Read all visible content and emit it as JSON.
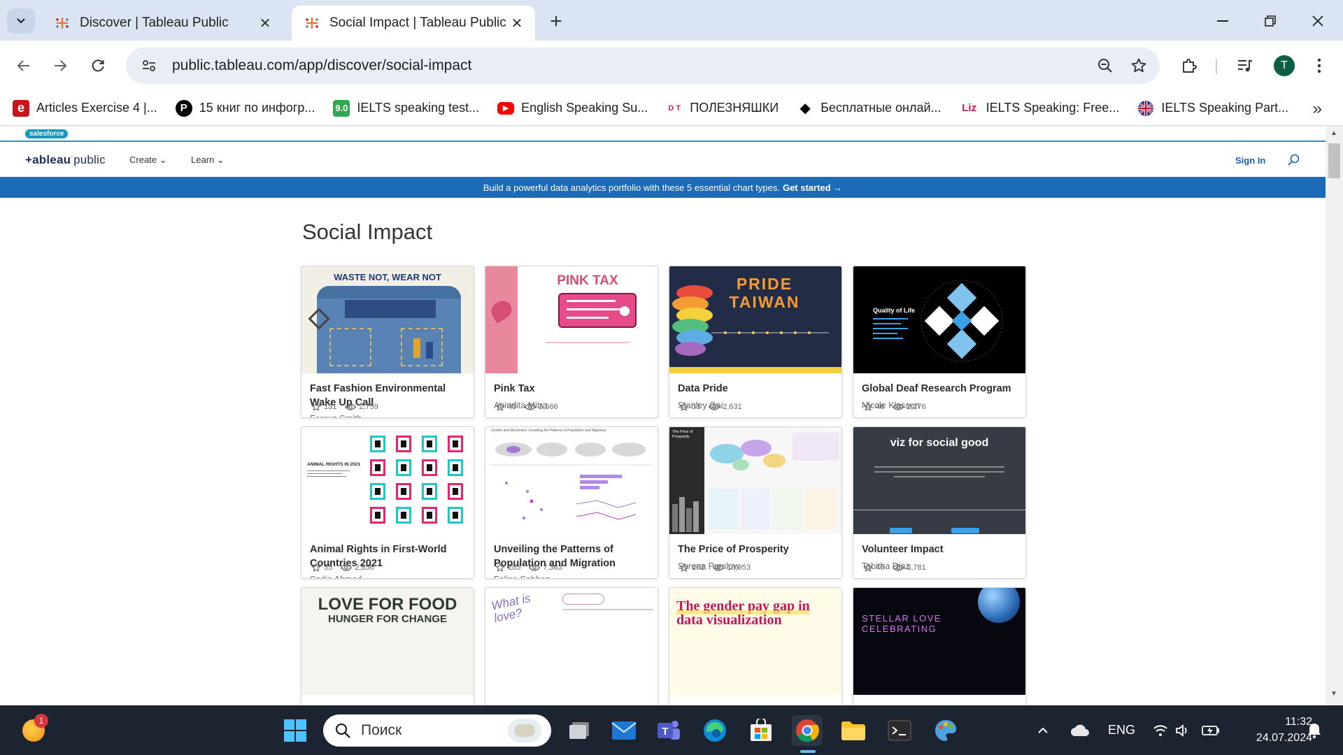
{
  "browser": {
    "tabs": [
      {
        "title": "Discover | Tableau Public",
        "active": false
      },
      {
        "title": "Social Impact | Tableau Public",
        "active": true
      }
    ],
    "url": "public.tableau.com/app/discover/social-impact",
    "profile_initial": "T",
    "bookmarks": [
      {
        "label": "Articles Exercise 4 |...",
        "icon": "e",
        "color": "#c4161c"
      },
      {
        "label": "15 книг по инфогр...",
        "icon": "P",
        "color": "#000000"
      },
      {
        "label": "IELTS speaking test...",
        "icon": "9.0",
        "color": "#2fa84f"
      },
      {
        "label": "English Speaking Su...",
        "icon": "▶",
        "color": "#ff0000"
      },
      {
        "label": "ПОЛЕЗНЯШКИ",
        "icon": "DT",
        "color": "#d81b60"
      },
      {
        "label": "Бесплатные онлай...",
        "icon": "◆",
        "color": "#000000"
      },
      {
        "label": "IELTS Speaking: Free...",
        "icon": "Liz",
        "color": "#c2185b"
      },
      {
        "label": "IELTS Speaking Part...",
        "icon": "uk",
        "color": "#1a237e"
      }
    ]
  },
  "site": {
    "salesforce_label": "salesforce",
    "logo": "+ableau",
    "logo_suffix": "public",
    "menu": [
      "Create",
      "Learn"
    ],
    "sign_in": "Sign In",
    "banner_text": "Build a powerful data analytics portfolio with these 5 essential chart types.",
    "banner_cta": "Get started →"
  },
  "page": {
    "title": "Social Impact",
    "cards": [
      {
        "title": "Fast Fashion Environmental Wake Up Call",
        "author": "Fergus Smith",
        "favorites": "131",
        "views": "2,759",
        "thumb_text": "WASTE NOT, WEAR NOT"
      },
      {
        "title": "Pink Tax",
        "author": "Anindita Mitra",
        "favorites": "45",
        "views": "3,566",
        "thumb_text": "PINK TAX"
      },
      {
        "title": "Data Pride",
        "author": "Stanley Gai",
        "favorites": "33",
        "views": "2,631",
        "thumb_text": "PRIDE TAIWAN"
      },
      {
        "title": "Global Deaf Research Program",
        "author": "Nicole Klassen",
        "favorites": "46",
        "views": "2,276",
        "thumb_text": "Quality of Life"
      },
      {
        "title": "Animal Rights in First-World Countries 2021",
        "author": "Sadia Ahmed",
        "favorites": "55",
        "views": "2,856",
        "thumb_text": "ANIMAL RIGHTS IN 2021"
      },
      {
        "title": "Unveiling the Patterns of Population and Migration",
        "author": "Felipe Sebben",
        "favorites": "185",
        "views": "7,363",
        "thumb_text": "Growth and Movement: Unveiling the Patterns of Population and Migration"
      },
      {
        "title": "The Price of Prosperity",
        "author": "Serena Purslow",
        "favorites": "262",
        "views": "10,953",
        "thumb_text": "The Price of Prosperity"
      },
      {
        "title": "Volunteer Impact",
        "author": "Tabitha Diaz",
        "favorites": "46",
        "views": "3,781",
        "thumb_text": "viz for social good"
      },
      {
        "thumb_text": "LOVE FOR FOOD",
        "thumb_sub": "HUNGER FOR CHANGE"
      },
      {
        "thumb_text": "What is love?"
      },
      {
        "thumb_text": "The gender pay gap in data visualization"
      },
      {
        "thumb_text": "STELLAR LOVE CELEBRATING"
      }
    ]
  },
  "taskbar": {
    "search_placeholder": "Поиск",
    "notification_count": "1",
    "language": "ENG",
    "time": "11:32",
    "date": "24.07.2024"
  }
}
